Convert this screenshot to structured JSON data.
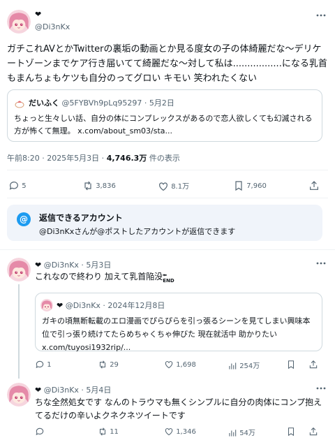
{
  "main": {
    "name_glyph": "❤",
    "handle": "@Di3nKx",
    "text": "ガチこれAVとかTwitterの裏垢の動画とか見る度女の子の体綺麗だな〜デリケートゾーンまでケア行き届いてて綺麗だな〜対して私は.................になる乳首もまんちょもケツも自分のってグロい キモい 笑われたくない",
    "quote": {
      "name": "だいふく",
      "handle_date": "@5FYBVh9pLq95297 · 5月2日",
      "text": "ちょっと生々しい話、自分の体にコンプレックスがあるので恋人欲しくても幻滅される方が怖くて無理。 x.com/about_sm03/sta..."
    },
    "time": "午前8:20 · 2025年5月3日 · ",
    "views": "4,746.3万",
    "views_suffix": " 件の表示",
    "stats": {
      "replies": "5",
      "retweets": "3,836",
      "likes": "8.1万",
      "bookmarks": "7,960"
    }
  },
  "notice": {
    "badge": "@",
    "title": "返信できるアカウント",
    "subtitle": "@Di3nKxさんが@ポストしたアカウントが返信できます"
  },
  "replies": [
    {
      "name_glyph": "❤",
      "handle_date": "@Di3nKx · 5月3日",
      "text": "これなので終わり 加えて乳首陥没",
      "end_mark": "END",
      "quote": {
        "name_glyph": "❤",
        "handle_date": "@Di3nKx · 2024年12月8日",
        "text": "ガキの頃無断転載のエロ漫画でぴらぴらを引っ張るシーンを見てしまい興味本位で引っ張り続けてたらめちゃくちゃ伸びた 現在就活中 助かりたい x.com/tuyosi1932rip/..."
      },
      "stats": {
        "replies": "1",
        "retweets": "29",
        "likes": "1,698",
        "views": "254万"
      }
    },
    {
      "name_glyph": "❤",
      "handle_date": "@Di3nKx · 5月4日",
      "text": "ちな全然処女です なんのトラウマも無くシンプルに自分の肉体にコンプ抱えてるだけの辛いよクネクネツイートです",
      "stats": {
        "replies": "",
        "retweets": "11",
        "likes": "1,346",
        "views": "54万"
      }
    }
  ],
  "colors": {
    "accent": "#1d9bf0",
    "secondary_text": "#536471",
    "border": "#cfd9de",
    "notice_bg": "#f0f4fa"
  }
}
